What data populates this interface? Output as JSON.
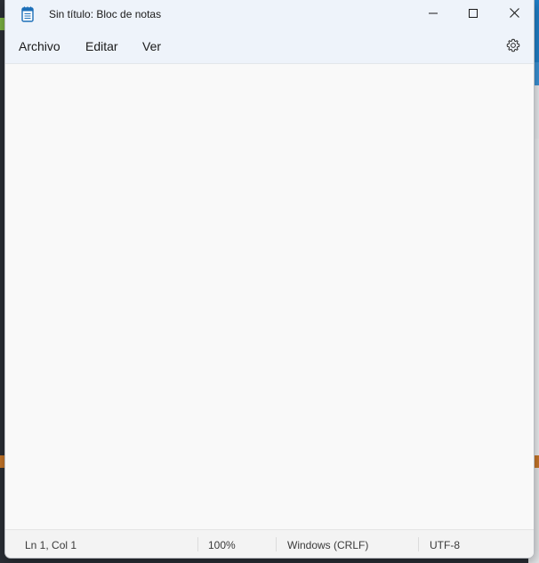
{
  "window": {
    "title": "Sin título: Bloc de notas",
    "app_icon": "notepad-icon"
  },
  "caption_buttons": {
    "minimize_icon": "minimize-icon",
    "maximize_icon": "maximize-icon",
    "close_icon": "close-icon"
  },
  "menubar": {
    "items": [
      {
        "label": "Archivo"
      },
      {
        "label": "Editar"
      },
      {
        "label": "Ver"
      }
    ],
    "settings_icon": "gear-icon"
  },
  "editor": {
    "content": ""
  },
  "statusbar": {
    "position": "Ln 1, Col 1",
    "zoom": "100%",
    "line_ending": "Windows (CRLF)",
    "encoding": "UTF-8"
  },
  "colors": {
    "titlebar_bg": "#eef3fa",
    "editor_bg": "#f9f9f9",
    "statusbar_bg": "#f3f3f3",
    "icon_accent": "#1c6fb8"
  }
}
